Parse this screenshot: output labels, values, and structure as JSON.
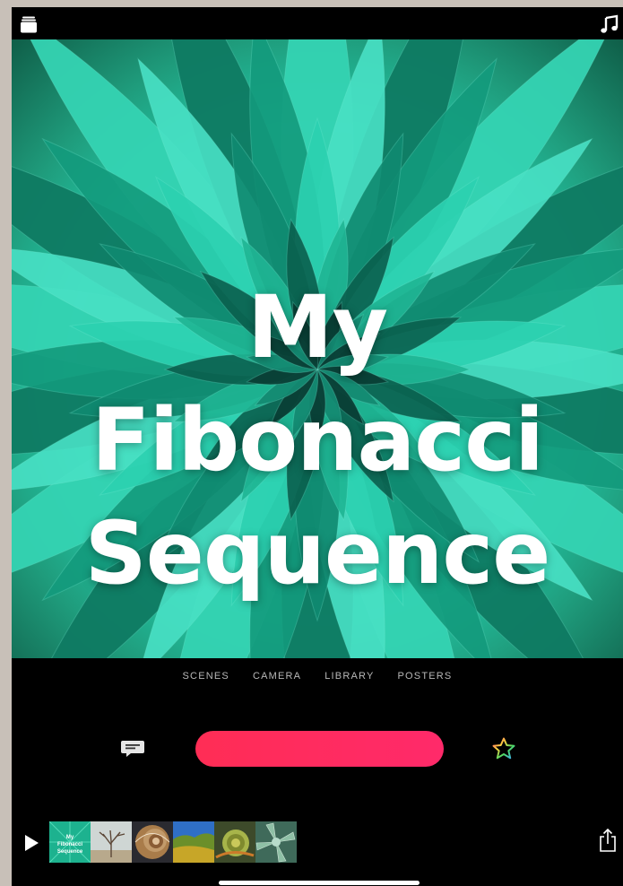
{
  "header": {
    "left_icon": "projects-icon",
    "right_icon": "music-note-icon"
  },
  "poster": {
    "title_lines": [
      "My",
      "Fibonacci",
      "Sequence"
    ]
  },
  "tabs": [
    {
      "label": "SCENES"
    },
    {
      "label": "CAMERA"
    },
    {
      "label": "LIBRARY"
    },
    {
      "label": "POSTERS"
    }
  ],
  "toolbar": {
    "captions_icon": "captions-icon",
    "record_color": "#ff2d55",
    "effects_icon": "star-icon"
  },
  "timeline": {
    "play_icon": "play-icon",
    "clips": [
      {
        "label": "My Fibonacci Sequence",
        "kind": "poster"
      },
      {
        "label": "",
        "kind": "tree"
      },
      {
        "label": "",
        "kind": "shell"
      },
      {
        "label": "",
        "kind": "field"
      },
      {
        "label": "",
        "kind": "chameleon"
      },
      {
        "label": "",
        "kind": "succulent"
      }
    ],
    "share_icon": "share-icon"
  }
}
